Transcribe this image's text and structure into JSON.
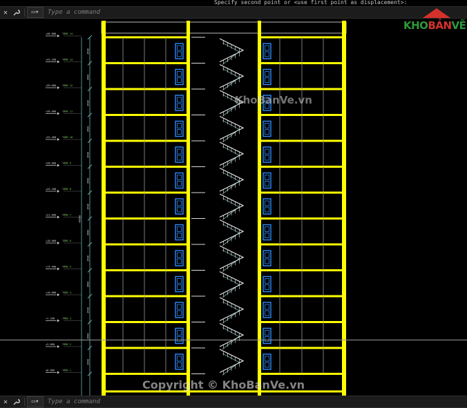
{
  "prompt_line": "Specify second point or <use first point as displacement>:",
  "command_bar": {
    "placeholder": "Type a command",
    "close_glyph": "✕",
    "wrench_glyph": "🔧",
    "dropdown_glyph": "▭▾"
  },
  "watermarks": {
    "center": "KhoBanVe.vn",
    "bottom": "Copyright © KhoBanVe.vn"
  },
  "logo": {
    "part1": "KHO",
    "part2": "BẢN",
    "part3": "VẼ",
    "green": "#2e9a3a",
    "red": "#d4312b"
  },
  "colors": {
    "column": "#ffff00",
    "slab": "#ffff00",
    "window": "#2b8cff",
    "stair": "#e6e6e6",
    "dim": "#7ad0d0"
  },
  "floors": {
    "count": 13,
    "elevation_labels": [
      "+46.800",
      "+43.200",
      "+39.600",
      "+36.000",
      "+32.400",
      "+28.800",
      "+25.200",
      "+21.600",
      "+18.000",
      "+14.400",
      "+10.800",
      "+7.200",
      "+3.600",
      "±0.000",
      "-1.500"
    ],
    "level_tags": [
      "TẦNG 14",
      "TẦNG 13",
      "TẦNG 12",
      "TẦNG 11",
      "TẦNG 10",
      "TẦNG 9",
      "TẦNG 8",
      "TẦNG 7",
      "TẦNG 6",
      "TẦNG 5",
      "TẦNG 4",
      "TẦNG 3",
      "TẦNG 2",
      "TẦNG 1",
      "NỀN"
    ],
    "dim_labels": [
      "3600",
      "3600",
      "3600",
      "3600",
      "3600",
      "3600",
      "3600",
      "3600",
      "3600",
      "3600",
      "3600",
      "3600",
      "3600",
      "4500"
    ],
    "overall_dim": "49500"
  }
}
